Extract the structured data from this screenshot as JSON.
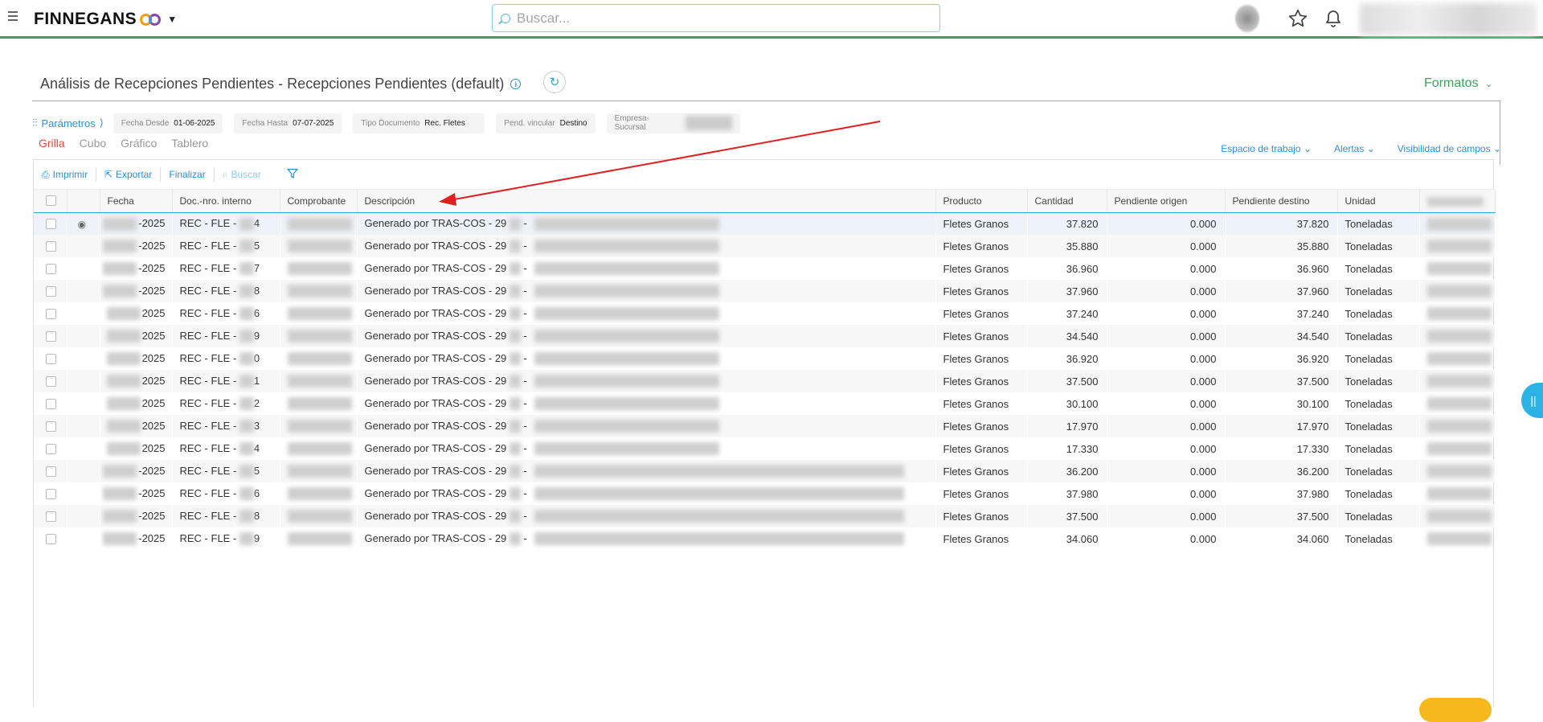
{
  "header": {
    "logo_text": "FINNEGANS",
    "search_placeholder": "Buscar..."
  },
  "page": {
    "title": "Análisis de Recepciones Pendientes - Recepciones Pendientes (default)",
    "formats_label": "Formatos"
  },
  "params": {
    "label": "Parámetros",
    "items": [
      {
        "key": "Fecha Desde",
        "value": "01-06-2025"
      },
      {
        "key": "Fecha Hasta",
        "value": "07-07-2025"
      },
      {
        "key": "Tipo Documento",
        "value": "Rec. Fletes"
      },
      {
        "key": "Pend. vincular",
        "value": "Destino"
      },
      {
        "key": "Empresa-Sucursal",
        "value": ""
      }
    ]
  },
  "view_tabs": [
    "Grilla",
    "Cubo",
    "Gráfico",
    "Tablero"
  ],
  "right_links": [
    "Espacio de trabajo",
    "Alertas",
    "Visibilidad de campos"
  ],
  "toolbar": {
    "print": "Imprimir",
    "export": "Exportar",
    "finish": "Finalizar",
    "search": "Buscar"
  },
  "columns": [
    "Fecha",
    "Doc.-nro. interno",
    "Comprobante",
    "Descripción",
    "Producto",
    "Cantidad",
    "Pendiente origen",
    "Pendiente destino",
    "Unidad"
  ],
  "rows": [
    {
      "fecha": "-2025",
      "doc_prefix": "REC - FLE -",
      "doc_suffix": "4",
      "desc": "Generado por TRAS-COS - 29",
      "producto": "Fletes Granos",
      "cantidad": "37.820",
      "pend_origen": "0.000",
      "pend_destino": "37.820",
      "unidad": "Toneladas"
    },
    {
      "fecha": "-2025",
      "doc_prefix": "REC - FLE -",
      "doc_suffix": "5",
      "desc": "Generado por TRAS-COS - 29",
      "producto": "Fletes Granos",
      "cantidad": "35.880",
      "pend_origen": "0.000",
      "pend_destino": "35.880",
      "unidad": "Toneladas"
    },
    {
      "fecha": "-2025",
      "doc_prefix": "REC - FLE -",
      "doc_suffix": "7",
      "desc": "Generado por TRAS-COS - 29",
      "producto": "Fletes Granos",
      "cantidad": "36.960",
      "pend_origen": "0.000",
      "pend_destino": "36.960",
      "unidad": "Toneladas"
    },
    {
      "fecha": "-2025",
      "doc_prefix": "REC - FLE -",
      "doc_suffix": "8",
      "desc": "Generado por TRAS-COS - 29",
      "producto": "Fletes Granos",
      "cantidad": "37.960",
      "pend_origen": "0.000",
      "pend_destino": "37.960",
      "unidad": "Toneladas"
    },
    {
      "fecha": "2025",
      "doc_prefix": "REC - FLE -",
      "doc_suffix": "6",
      "desc": "Generado por TRAS-COS - 29",
      "producto": "Fletes Granos",
      "cantidad": "37.240",
      "pend_origen": "0.000",
      "pend_destino": "37.240",
      "unidad": "Toneladas"
    },
    {
      "fecha": "2025",
      "doc_prefix": "REC - FLE -",
      "doc_suffix": "9",
      "desc": "Generado por TRAS-COS - 29",
      "producto": "Fletes Granos",
      "cantidad": "34.540",
      "pend_origen": "0.000",
      "pend_destino": "34.540",
      "unidad": "Toneladas"
    },
    {
      "fecha": "2025",
      "doc_prefix": "REC - FLE -",
      "doc_suffix": "0",
      "desc": "Generado por TRAS-COS - 29",
      "producto": "Fletes Granos",
      "cantidad": "36.920",
      "pend_origen": "0.000",
      "pend_destino": "36.920",
      "unidad": "Toneladas"
    },
    {
      "fecha": "2025",
      "doc_prefix": "REC - FLE -",
      "doc_suffix": "1",
      "desc": "Generado por TRAS-COS - 29",
      "producto": "Fletes Granos",
      "cantidad": "37.500",
      "pend_origen": "0.000",
      "pend_destino": "37.500",
      "unidad": "Toneladas"
    },
    {
      "fecha": "2025",
      "doc_prefix": "REC - FLE -",
      "doc_suffix": "2",
      "desc": "Generado por TRAS-COS - 29",
      "producto": "Fletes Granos",
      "cantidad": "30.100",
      "pend_origen": "0.000",
      "pend_destino": "30.100",
      "unidad": "Toneladas"
    },
    {
      "fecha": "2025",
      "doc_prefix": "REC - FLE -",
      "doc_suffix": "3",
      "desc": "Generado por TRAS-COS - 29",
      "producto": "Fletes Granos",
      "cantidad": "17.970",
      "pend_origen": "0.000",
      "pend_destino": "17.970",
      "unidad": "Toneladas"
    },
    {
      "fecha": "2025",
      "doc_prefix": "REC - FLE -",
      "doc_suffix": "4",
      "desc": "Generado por TRAS-COS - 29",
      "producto": "Fletes Granos",
      "cantidad": "17.330",
      "pend_origen": "0.000",
      "pend_destino": "17.330",
      "unidad": "Toneladas"
    },
    {
      "fecha": "-2025",
      "doc_prefix": "REC - FLE -",
      "doc_suffix": "5",
      "desc": "Generado por TRAS-COS - 29",
      "producto": "Fletes Granos",
      "cantidad": "36.200",
      "pend_origen": "0.000",
      "pend_destino": "36.200",
      "unidad": "Toneladas"
    },
    {
      "fecha": "-2025",
      "doc_prefix": "REC - FLE -",
      "doc_suffix": "6",
      "desc": "Generado por TRAS-COS - 29",
      "producto": "Fletes Granos",
      "cantidad": "37.980",
      "pend_origen": "0.000",
      "pend_destino": "37.980",
      "unidad": "Toneladas"
    },
    {
      "fecha": "-2025",
      "doc_prefix": "REC - FLE -",
      "doc_suffix": "8",
      "desc": "Generado por TRAS-COS - 29",
      "producto": "Fletes Granos",
      "cantidad": "37.500",
      "pend_origen": "0.000",
      "pend_destino": "37.500",
      "unidad": "Toneladas"
    },
    {
      "fecha": "-2025",
      "doc_prefix": "REC - FLE -",
      "doc_suffix": "9",
      "desc": "Generado por TRAS-COS - 29",
      "producto": "Fletes Granos",
      "cantidad": "34.060",
      "pend_origen": "0.000",
      "pend_destino": "34.060",
      "unidad": "Toneladas"
    }
  ],
  "colors": {
    "accent_blue": "#2b8fd9",
    "brand_green": "#3aa35e",
    "active_tab_red": "#e74c3c",
    "annotation_arrow": "#e02020"
  }
}
